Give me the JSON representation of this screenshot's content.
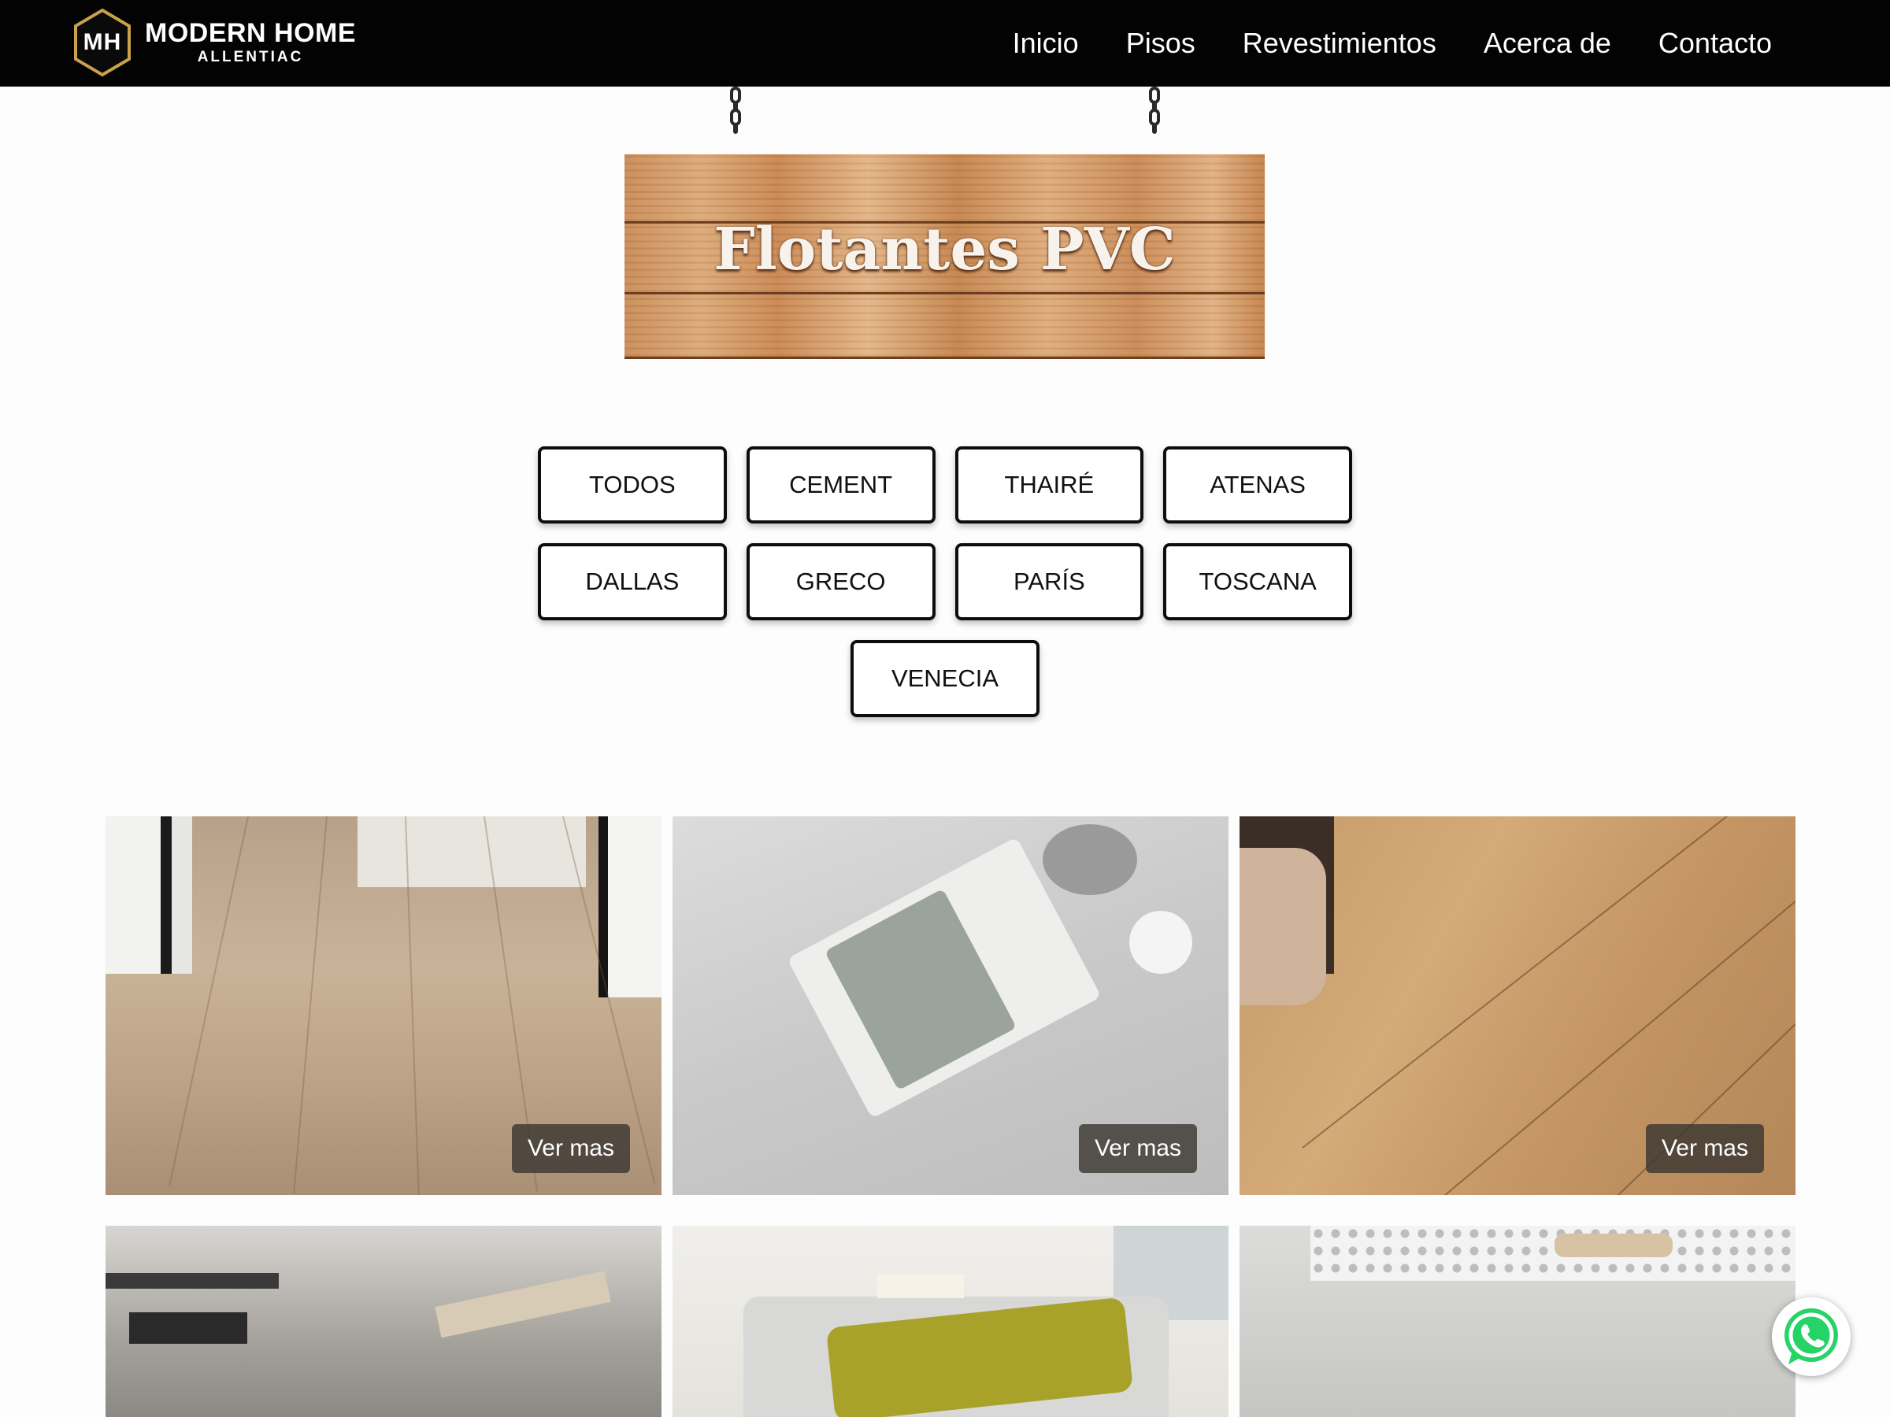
{
  "brand": {
    "initials": "MH",
    "name": "MODERN HOME",
    "sub": "ALLENTIAC"
  },
  "nav": {
    "items": [
      "Inicio",
      "Pisos",
      "Revestimientos",
      "Acerca de",
      "Contacto"
    ]
  },
  "hero": {
    "title": "Flotantes PVC"
  },
  "filters": {
    "rows": [
      [
        "TODOS",
        "CEMENT",
        "THAIRÉ",
        "ATENAS"
      ],
      [
        "DALLAS",
        "GRECO",
        "PARÍS",
        "TOSCANA"
      ],
      [
        "VENECIA"
      ]
    ]
  },
  "products": {
    "more_label": "Ver mas"
  },
  "colors": {
    "nav_bg": "#030303",
    "logo_gold": "#c9a24a",
    "whatsapp": "#25d366"
  },
  "icons": [
    "logo-hexagon-icon",
    "chain-icon",
    "whatsapp-icon"
  ]
}
